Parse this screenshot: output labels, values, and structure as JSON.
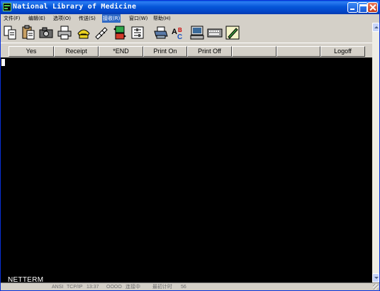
{
  "window": {
    "title": "National Library of Medicine",
    "controls": [
      "minimize",
      "maximize",
      "close"
    ]
  },
  "menu": {
    "items": [
      {
        "label": "文件(F)",
        "active": false
      },
      {
        "label": "编辑(E)",
        "active": false
      },
      {
        "label": "选项(O)",
        "active": false
      },
      {
        "label": "传送(S)",
        "active": false
      },
      {
        "label": "接收(R)",
        "active": true
      },
      {
        "label": "窗口(W)",
        "active": false
      },
      {
        "label": "帮助(H)",
        "active": false
      }
    ]
  },
  "toolbar": {
    "icons": [
      "copy-icon",
      "paste-icon",
      "camera-icon",
      "print-icon",
      "phone-dial-icon",
      "hangup-icon",
      "transfer-icon",
      "settings-icon",
      "printer-setup-icon",
      "spell-check-icon",
      "terminal-icon",
      "keyboard-icon",
      "edit-icon"
    ]
  },
  "function_keys": [
    "Yes",
    "Receipt",
    "*END",
    "Print On",
    "Print Off",
    "",
    "",
    "Logoff"
  ],
  "terminal": {
    "brand": "NETTERM",
    "background": "#000000",
    "foreground": "#ffffff"
  },
  "status": {
    "cells": [
      "ANSI",
      "TCP/IP",
      "13:37",
      "OOOO",
      "连接中",
      "最初计时",
      "56"
    ]
  },
  "colors": {
    "titlebar": "#0556d8",
    "menu_active": "#316ac5",
    "window_bg": "#d4d0c8"
  }
}
